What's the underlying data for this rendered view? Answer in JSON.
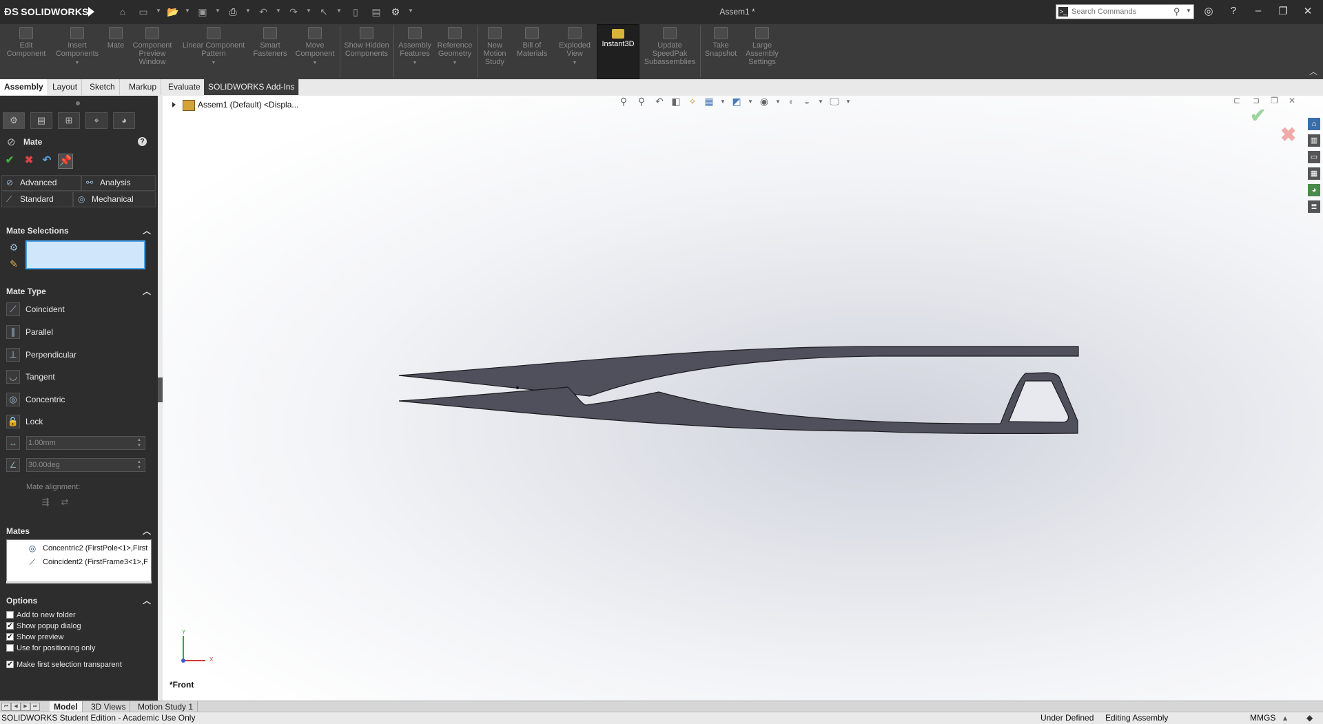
{
  "app": {
    "logo_text": "SOLIDWORKS",
    "document_title": "Assem1 *"
  },
  "search": {
    "placeholder": "Search Commands"
  },
  "ribbon": {
    "commands": [
      {
        "label": "Edit Component"
      },
      {
        "label": "Insert Components"
      },
      {
        "label": "Mate"
      },
      {
        "label": "Component Preview Window"
      },
      {
        "label": "Linear Component Pattern"
      },
      {
        "label": "Smart Fasteners"
      },
      {
        "label": "Move Component"
      },
      {
        "label": "Show Hidden Components"
      },
      {
        "label": "Assembly Features"
      },
      {
        "label": "Reference Geometry"
      },
      {
        "label": "New Motion Study"
      },
      {
        "label": "Bill of Materials"
      },
      {
        "label": "Exploded View"
      },
      {
        "label": "Instant3D"
      },
      {
        "label": "Update SpeedPak Subassemblies"
      },
      {
        "label": "Take Snapshot"
      },
      {
        "label": "Large Assembly Settings"
      }
    ]
  },
  "tabs": [
    "Assembly",
    "Layout",
    "Sketch",
    "Markup",
    "Evaluate",
    "SOLIDWORKS Add-Ins"
  ],
  "property_manager": {
    "title": "Mate",
    "help": "?",
    "mode_tabs": {
      "advanced": "Advanced",
      "analysis": "Analysis",
      "standard": "Standard",
      "mechanical": "Mechanical"
    },
    "mate_selections_title": "Mate Selections",
    "mate_type_title": "Mate Type",
    "mate_types": [
      "Coincident",
      "Parallel",
      "Perpendicular",
      "Tangent",
      "Concentric",
      "Lock"
    ],
    "distance_value": "1.00mm",
    "angle_value": "30.00deg",
    "mate_alignment_label": "Mate alignment:",
    "mates_title": "Mates",
    "mates": [
      {
        "text": "Concentric2 (FirstPole<1>,First",
        "icon": "concentric-icon"
      },
      {
        "text": "Coincident2 (FirstFrame3<1>,F",
        "icon": "coincident-icon"
      }
    ],
    "options_title": "Options",
    "options": [
      {
        "label": "Add to new folder",
        "checked": false
      },
      {
        "label": "Show popup dialog",
        "checked": true
      },
      {
        "label": "Show preview",
        "checked": true
      },
      {
        "label": "Use for positioning only",
        "checked": false
      },
      {
        "label": "Make first selection transparent",
        "checked": true
      }
    ]
  },
  "tree": {
    "root": "Assem1 (Default) <Displa..."
  },
  "viewport": {
    "view_name": "*Front",
    "axis_y": "Y",
    "axis_x": "X"
  },
  "bottom_tabs": [
    "Model",
    "3D Views",
    "Motion Study 1"
  ],
  "status": {
    "edition": "SOLIDWORKS Student Edition - Academic Use Only",
    "definition": "Under Defined",
    "mode": "Editing Assembly",
    "units": "MMGS"
  },
  "colors": {
    "part_fill": "#4f505c",
    "accent": "#4aa3e8",
    "panel": "#2d2d2d"
  }
}
